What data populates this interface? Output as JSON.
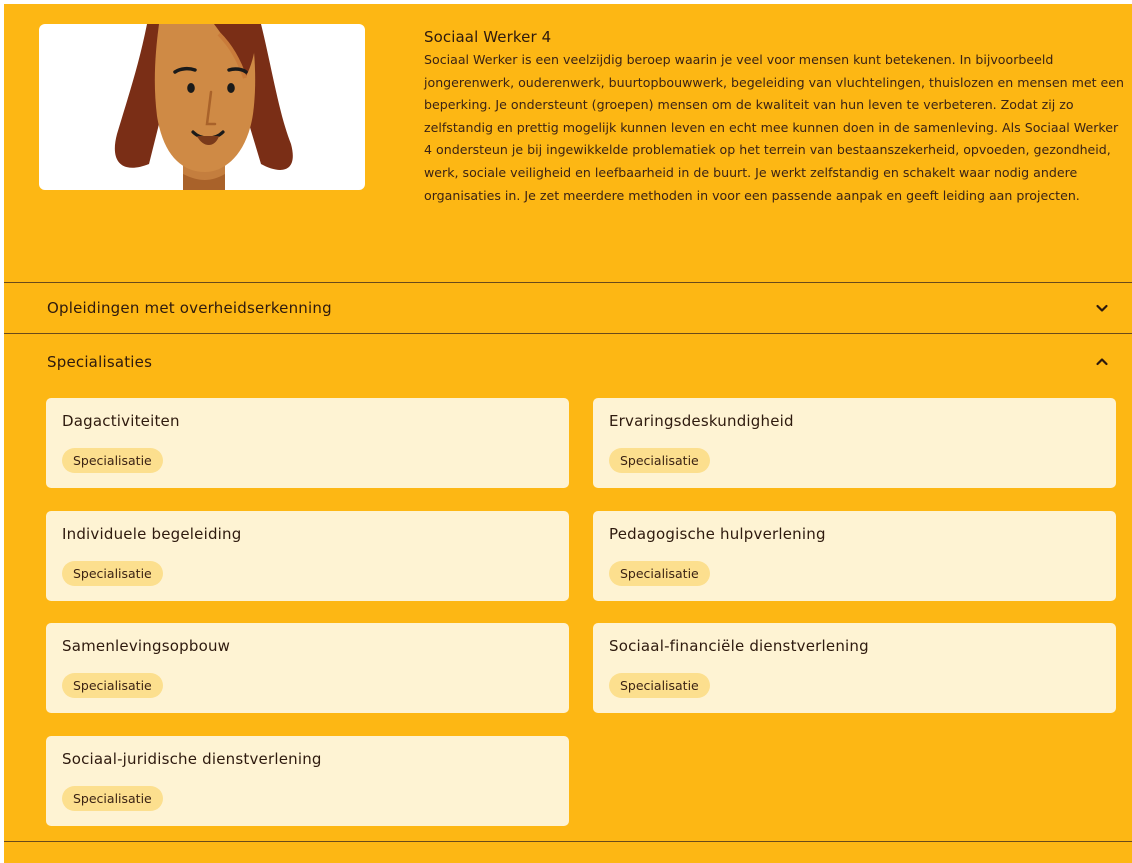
{
  "intro": {
    "title": "Sociaal Werker 4",
    "paragraph": "Sociaal Werker is een veelzijdig beroep waarin je veel voor mensen kunt betekenen. In bijvoorbeeld jongerenwerk, ouderenwerk, buurtopbouwwerk, begeleiding van vluchtelingen, thuislozen en mensen met een beperking. Je ondersteunt (groepen) mensen om de kwaliteit van hun leven te verbeteren. Zodat zij zo zelfstandig en prettig mogelijk kunnen leven en echt mee kunnen doen in de samenleving. Als Sociaal Werker 4 ondersteun je bij ingewikkelde problematiek op het terrein van bestaanszekerheid, opvoeden, gezondheid, werk, sociale veiligheid en leefbaarheid in de buurt. Je werkt zelfstandig en schakelt waar nodig andere organisaties in. Je zet meerdere methoden in voor een passende aanpak en geeft leiding aan projecten.",
    "illustration": "woman-portrait-illustration"
  },
  "accordions": [
    {
      "label": "Opleidingen met overheidserkenning",
      "expanded": false,
      "icon": "chevron-down-icon"
    },
    {
      "label": "Specialisaties",
      "expanded": true,
      "icon": "chevron-up-icon"
    }
  ],
  "specialisations": [
    {
      "title": "Dagactiviteiten",
      "tag": "Specialisatie"
    },
    {
      "title": "Ervaringsdeskundigheid",
      "tag": "Specialisatie"
    },
    {
      "title": "Individuele begeleiding",
      "tag": "Specialisatie"
    },
    {
      "title": "Pedagogische hulpverlening",
      "tag": "Specialisatie"
    },
    {
      "title": "Samenlevingsopbouw",
      "tag": "Specialisatie"
    },
    {
      "title": "Sociaal-financiële dienstverlening",
      "tag": "Specialisatie"
    },
    {
      "title": "Sociaal-juridische dienstverlening",
      "tag": "Specialisatie"
    }
  ],
  "colors": {
    "panel_background": "#FDB714",
    "card_background": "#FEF3D3",
    "tag_background": "#FCDF8E",
    "text": "#2e1a0e"
  }
}
